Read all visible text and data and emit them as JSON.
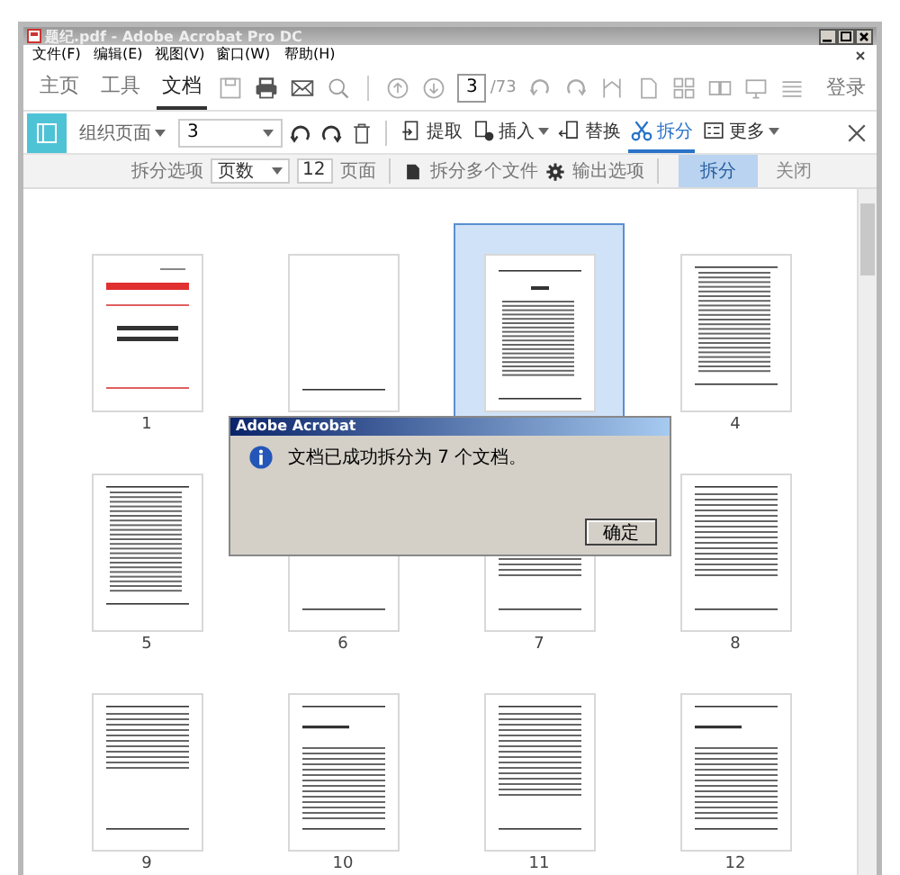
{
  "window": {
    "title": "题纪.pdf - Adobe Acrobat Pro DC"
  },
  "menu": [
    "文件(F)",
    "编辑(E)",
    "视图(V)",
    "窗口(W)",
    "帮助(H)"
  ],
  "tabs": [
    {
      "label": "主页",
      "selected": false
    },
    {
      "label": "工具",
      "selected": false
    },
    {
      "label": "文档",
      "selected": true
    }
  ],
  "page_nav": {
    "value": "3",
    "total": "/73"
  },
  "sign_in": "登录",
  "organize_bar": {
    "title": "组织页面",
    "page_range": "3",
    "tools": [
      {
        "label": "提取",
        "kind": "extract",
        "selected": false,
        "dropdown": false
      },
      {
        "label": "插入",
        "kind": "insert",
        "selected": false,
        "dropdown": true
      },
      {
        "label": "替换",
        "kind": "replace",
        "selected": false,
        "dropdown": false
      },
      {
        "label": "拆分",
        "kind": "split",
        "selected": true,
        "dropdown": false
      },
      {
        "label": "更多",
        "kind": "more",
        "selected": false,
        "dropdown": true
      }
    ]
  },
  "split_bar": {
    "options_label": "拆分选项",
    "split_by": "页数",
    "count": "12",
    "unit": "页面",
    "multi_files": "拆分多个文件",
    "output_options": "输出选项",
    "split_button": "拆分",
    "close_button": "关闭"
  },
  "pages": [
    {
      "label": "1",
      "kind": "cover",
      "selected": false
    },
    {
      "kind": "blank",
      "selected": false
    },
    {
      "kind": "toc",
      "selected": true
    },
    {
      "label": "4",
      "kind": "list",
      "selected": false
    },
    {
      "label": "5",
      "kind": "list",
      "selected": false
    },
    {
      "label": "6",
      "kind": "blank",
      "selected": false
    },
    {
      "label": "7",
      "kind": "text",
      "selected": false
    },
    {
      "label": "8",
      "kind": "text",
      "selected": false
    },
    {
      "label": "9",
      "kind": "short",
      "selected": false
    },
    {
      "label": "10",
      "kind": "chapter",
      "selected": false
    },
    {
      "label": "11",
      "kind": "text",
      "selected": false
    },
    {
      "label": "12",
      "kind": "chapter",
      "selected": false
    }
  ],
  "dialog": {
    "title": "Adobe Acrobat",
    "message": "文档已成功拆分为 7 个文档。",
    "button": "确定"
  }
}
